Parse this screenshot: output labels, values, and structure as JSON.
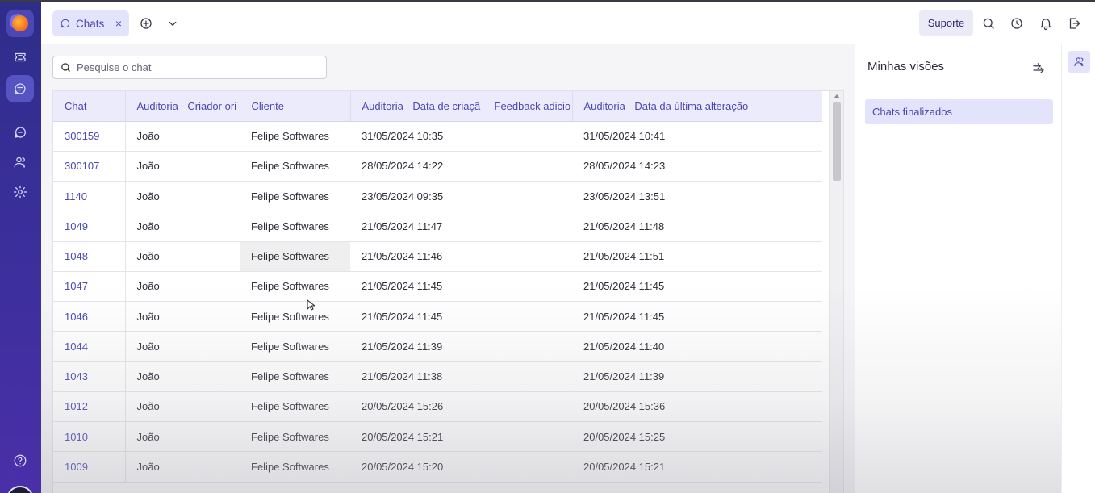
{
  "topbar": {
    "tab_label": "Chats",
    "tab_close": "×",
    "support_label": "Suporte"
  },
  "search": {
    "placeholder": "Pesquise o chat"
  },
  "table": {
    "columns": [
      "Chat",
      "Auditoria - Criador ori",
      "Cliente",
      "Auditoria - Data de criaçã",
      "Feedback adicio",
      "Auditoria - Data da última alteração"
    ],
    "rows": [
      [
        "300159",
        "João",
        "Felipe Softwares",
        "31/05/2024 10:35",
        "",
        "31/05/2024 10:41"
      ],
      [
        "300107",
        "João",
        "Felipe Softwares",
        "28/05/2024 14:22",
        "",
        "28/05/2024 14:23"
      ],
      [
        "1140",
        "João",
        "Felipe Softwares",
        "23/05/2024 09:35",
        "",
        "23/05/2024 13:51"
      ],
      [
        "1049",
        "João",
        "Felipe Softwares",
        "21/05/2024 11:47",
        "",
        "21/05/2024 11:48"
      ],
      [
        "1048",
        "João",
        "Felipe Softwares",
        "21/05/2024 11:46",
        "",
        "21/05/2024 11:51"
      ],
      [
        "1047",
        "João",
        "Felipe Softwares",
        "21/05/2024 11:45",
        "",
        "21/05/2024 11:45"
      ],
      [
        "1046",
        "João",
        "Felipe Softwares",
        "21/05/2024 11:45",
        "",
        "21/05/2024 11:45"
      ],
      [
        "1044",
        "João",
        "Felipe Softwares",
        "21/05/2024 11:39",
        "",
        "21/05/2024 11:40"
      ],
      [
        "1043",
        "João",
        "Felipe Softwares",
        "21/05/2024 11:38",
        "",
        "21/05/2024 11:39"
      ],
      [
        "1012",
        "João",
        "Felipe Softwares",
        "20/05/2024 15:26",
        "",
        "20/05/2024 15:36"
      ],
      [
        "1010",
        "João",
        "Felipe Softwares",
        "20/05/2024 15:21",
        "",
        "20/05/2024 15:25"
      ],
      [
        "1009",
        "João",
        "Felipe Softwares",
        "20/05/2024 15:20",
        "",
        "20/05/2024 15:21"
      ]
    ]
  },
  "panel": {
    "title": "Minhas visões",
    "views": [
      "Chats finalizados"
    ]
  },
  "icons": {
    "rail": [
      "logo",
      "ticket-icon",
      "chats-icon",
      "message-icon",
      "users-icon",
      "settings-icon",
      "help-icon"
    ],
    "topbar": [
      "add-tab-icon",
      "chevron-down-icon",
      "search-icon",
      "history-icon",
      "bell-icon",
      "logout-icon"
    ]
  },
  "colors": {
    "accent": "#4b47b4",
    "rail_top": "#2e2d8a",
    "rail_bottom": "#4a2fa8",
    "tab_bg": "#e3e3fb"
  }
}
